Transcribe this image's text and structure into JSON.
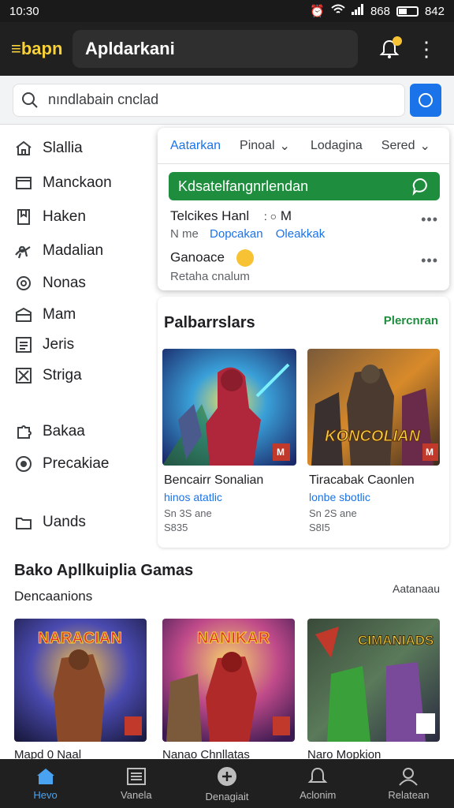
{
  "status_bar": {
    "time": "10:30",
    "battery": "842",
    "signal_text": "868"
  },
  "app_bar": {
    "brand": "≡bapn",
    "title": "Apldarkani"
  },
  "search": {
    "value": "nındlabain cnclad"
  },
  "sidebar": {
    "items": [
      {
        "label": "Slallia",
        "icon": "home-icon"
      },
      {
        "label": "Manckaon",
        "icon": "window-icon"
      },
      {
        "label": "Haken",
        "icon": "bookmark-page-icon"
      },
      {
        "label": "Madalian",
        "icon": "sports-icon"
      },
      {
        "label": "Nonas",
        "icon": "gear-icon"
      },
      {
        "label": "Mam",
        "icon": "archive-icon"
      },
      {
        "label": "Jeris",
        "icon": "list-icon"
      },
      {
        "label": "Striga",
        "icon": "close-box-icon"
      },
      {
        "label": "Bakaa",
        "icon": "puzzle-icon"
      },
      {
        "label": "Precakiae",
        "icon": "target-icon"
      },
      {
        "label": "Uands",
        "icon": "folder-icon"
      }
    ]
  },
  "dropdown": {
    "tabs": [
      "Aatarkan",
      "Pinoal",
      "Lodagina",
      "Sered"
    ],
    "green_bar": "Kdsatelfangnrlendan",
    "rows": [
      {
        "title": "Telcikes Hanl",
        "title_extra": "M",
        "sub1": "N me",
        "sub2": "Dopcakan",
        "sub3": "Oleakkak"
      },
      {
        "title": "Ganoace",
        "sub1": "Retaha cnalum"
      }
    ]
  },
  "featured": {
    "title": "Palbarrslars",
    "link": "Plercnran",
    "cards": [
      {
        "title": "Bencairr Sonalian",
        "subtitle": "hinos atatlic",
        "meta1": "Sn 3S ane",
        "meta2": "S835",
        "badge": "M"
      },
      {
        "title": "Tiracabak Caonlen",
        "subtitle": "lonbe sbotlic",
        "meta1": "Sn 2S ane",
        "meta2": "S8I5",
        "badge": "M",
        "banner": "KONCOLIAN"
      }
    ]
  },
  "bottom": {
    "title": "Bako Apllkuiplia Gamas",
    "subtitle": "Dencaanions",
    "link": "Aatanaau",
    "cards": [
      {
        "label": "Mapd 0 Naal",
        "banner": "NARACIAN"
      },
      {
        "label": "Nanao Chnllatas",
        "banner": "NANIKAR"
      },
      {
        "label": "Naro Mopkion",
        "banner": "CIMANIADS"
      }
    ]
  },
  "nav": {
    "items": [
      {
        "label": "Hevo",
        "icon": "home-icon"
      },
      {
        "label": "Vanela",
        "icon": "list-icon"
      },
      {
        "label": "Denagiait",
        "icon": "add-circle-icon"
      },
      {
        "label": "Aclonim",
        "icon": "bell-icon"
      },
      {
        "label": "Relatean",
        "icon": "profile-icon"
      }
    ]
  },
  "colors": {
    "accent": "#1a73e8",
    "green": "#1e8e3e",
    "bar_dark": "#202020",
    "brand_yellow": "#f7d13a"
  }
}
